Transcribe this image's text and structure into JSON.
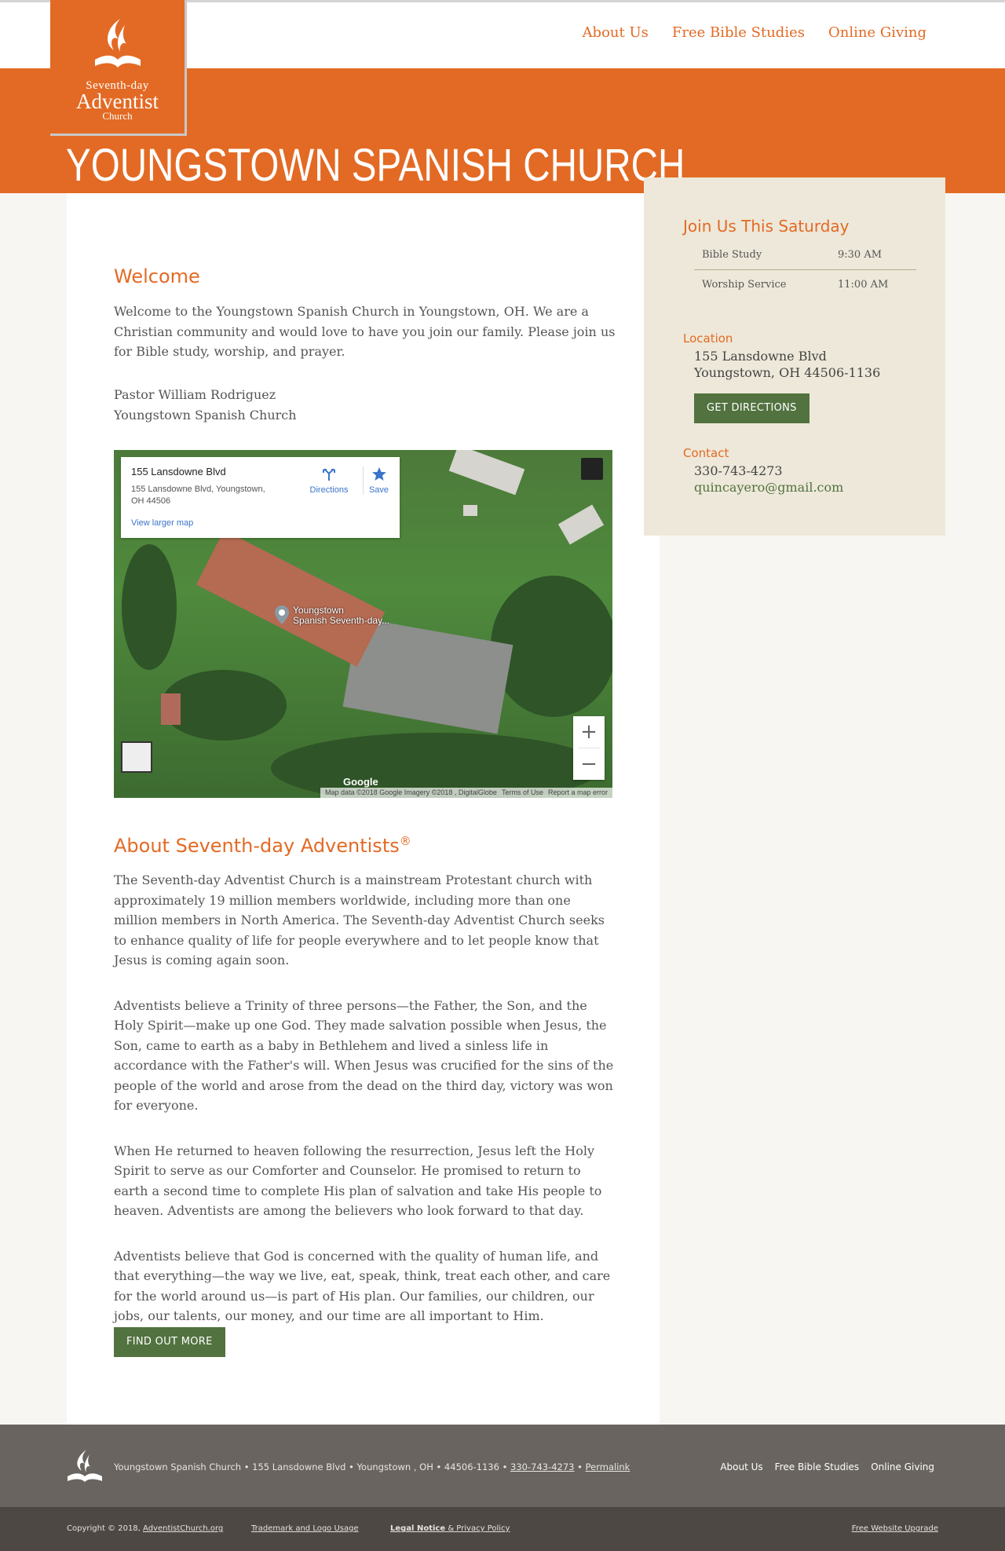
{
  "header": {
    "nav": [
      "About Us",
      "Free Bible Studies",
      "Online Giving"
    ]
  },
  "logo": {
    "line1": "Seventh-day",
    "line2": "Adventist",
    "line3": "Church"
  },
  "banner": {
    "title": "YOUNGSTOWN SPANISH CHURCH"
  },
  "welcome": {
    "heading": "Welcome",
    "text": "Welcome to the Youngstown Spanish Church in Youngstown, OH. We are a Christian community and would love to have you join our family. Please join us for Bible study, worship, and prayer.",
    "pastor": "Pastor William Rodriguez",
    "church": "Youngstown Spanish Church"
  },
  "map": {
    "card_title": "155 Lansdowne Blvd",
    "card_address": "155 Lansdowne Blvd, Youngstown, OH 44506",
    "larger_map": "View larger map",
    "directions": "Directions",
    "save": "Save",
    "pin_label_1": "Youngstown",
    "pin_label_2": "Spanish Seventh-day...",
    "zoom_in": "+",
    "zoom_out": "−",
    "logo": "Google",
    "attribution": [
      "Map data ©2018 Google Imagery ©2018 , DigitalGlobe",
      "Terms of Use",
      "Report a map error"
    ]
  },
  "about": {
    "heading": "About Seventh-day Adventists",
    "reg": "®",
    "paragraphs": [
      "The Seventh-day Adventist Church is a mainstream Protestant church with approximately 19 million members worldwide, including more than one million members in North America. The Seventh-day Adventist Church seeks to enhance quality of life for people everywhere and to let people know that Jesus is coming again soon.",
      "Adventists believe a Trinity of three persons—the Father, the Son, and the Holy Spirit—make up one God. They made salvation possible when Jesus, the Son, came to earth as a baby in Bethlehem and lived a sinless life in accordance with the Father's will. When Jesus was crucified for the sins of the people of the world and arose from the dead on the third day, victory was won for everyone.",
      "When He returned to heaven following the resurrection, Jesus left the Holy Spirit to serve as our Comforter and Counselor. He promised to return to earth a second time to complete His plan of salvation and take His people to heaven. Adventists are among the believers who look forward to that day.",
      "Adventists believe that God is concerned with the quality of human life, and that everything—the way we live, eat, speak, think, treat each other, and care for the world around us—is part of His plan. Our families, our children, our jobs, our talents, our money, and our time are all important to Him."
    ],
    "button": "Find Out More"
  },
  "sidebar": {
    "heading": "Join Us This Saturday",
    "schedule": [
      {
        "name": "Bible Study",
        "time": "9:30 AM"
      },
      {
        "name": "Worship Service",
        "time": "11:00 AM"
      }
    ],
    "location_heading": "Location",
    "address1": "155 Lansdowne Blvd",
    "address2": "Youngstown, OH 44506-1136",
    "directions_button": "Get Directions",
    "contact_heading": "Contact",
    "phone": "330-743-4273",
    "email": "quincayero@gmail.com"
  },
  "footer": {
    "info": "Youngstown Spanish Church • 155 Lansdowne Blvd • Youngstown , OH • 44506-1136 •",
    "phone": "330-743-4273",
    "sep": "•",
    "permalink": "Permalink",
    "nav": [
      "About Us",
      "Free Bible Studies",
      "Online Giving"
    ],
    "copyright": "Copyright © 2018,",
    "copyright_link": "AdventistChurch.org",
    "trademark": "Trademark and Logo Usage",
    "legal": "Legal Notice",
    "privacy": "& Privacy Policy",
    "upgrade": "Free Website Upgrade"
  },
  "colors": {
    "accent": "#e36a24",
    "green": "#52723f",
    "sidebar_bg": "#ede8d9",
    "footer_bg": "#69645f"
  }
}
